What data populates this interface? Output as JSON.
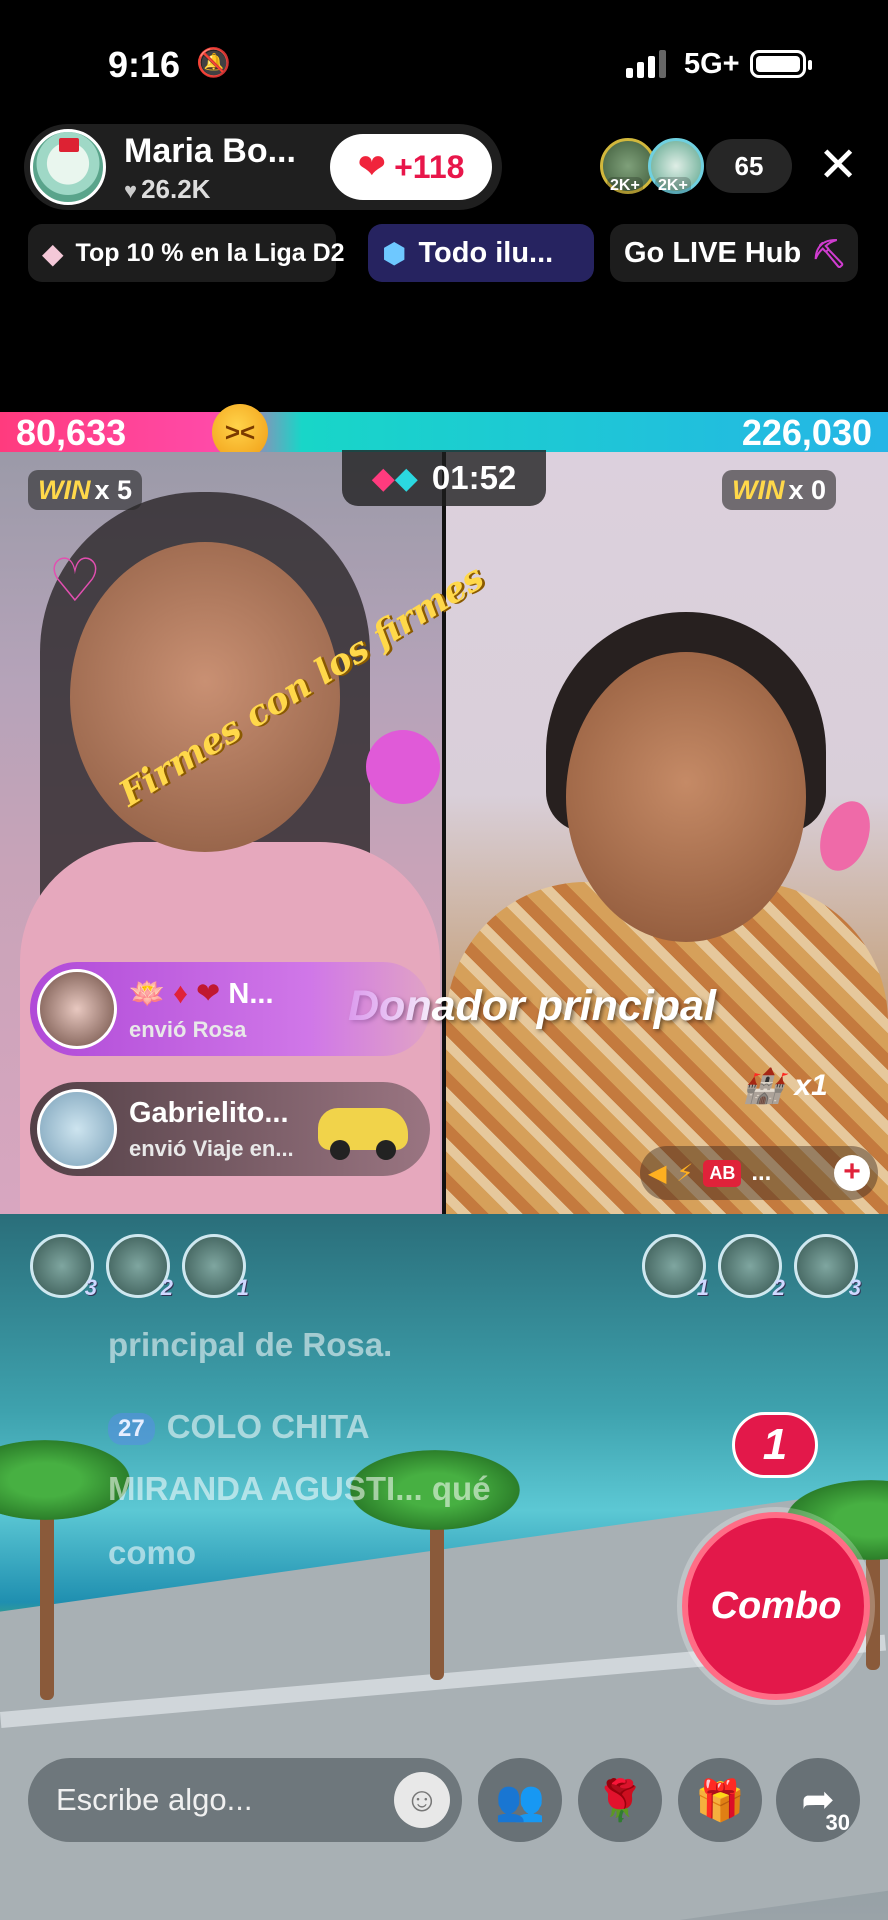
{
  "status_bar": {
    "time": "9:16",
    "network": "5G+"
  },
  "host": {
    "name": "Maria Bo...",
    "likes": "26.2K",
    "like_count_label": "+118"
  },
  "viewers": {
    "badges": [
      "2K+",
      "2K+"
    ],
    "count": "65"
  },
  "chips": {
    "league": "Top 10 % en la Liga D2",
    "todo": "Todo ilu...",
    "golive": "Go LIVE Hub"
  },
  "battle": {
    "left_score": "80,633",
    "right_score": "226,030",
    "timer": "01:52",
    "left_win_label": "WIN",
    "left_win_count": "x 5",
    "right_win_label": "WIN",
    "right_win_count": "x 0"
  },
  "overlays": {
    "firmes": "Firmes con los firmes",
    "donador": "Donador principal",
    "multiplier": "x1",
    "mini_badge": "AB",
    "mini_more": "..."
  },
  "toasts": [
    {
      "name": "N...",
      "action": "envió Rosa"
    },
    {
      "name": "Gabrielito...",
      "action": "envió Viaje en..."
    }
  ],
  "ranks_left": [
    "3",
    "2",
    "1"
  ],
  "ranks_right": [
    "1",
    "2",
    "3"
  ],
  "chat": [
    "principal de Rosa.",
    "COLO CHITA",
    "MIRANDA AGUSTI... qué",
    "como"
  ],
  "chat_level": "27",
  "combo": {
    "count": "1",
    "label": "Combo"
  },
  "input": {
    "placeholder": "Escribe algo..."
  },
  "share_count": "30",
  "colors": {
    "accent": "#e3184a",
    "battle_left": "#ff3b7e",
    "battle_right": "#25b5e6",
    "win": "#ffd84a"
  }
}
